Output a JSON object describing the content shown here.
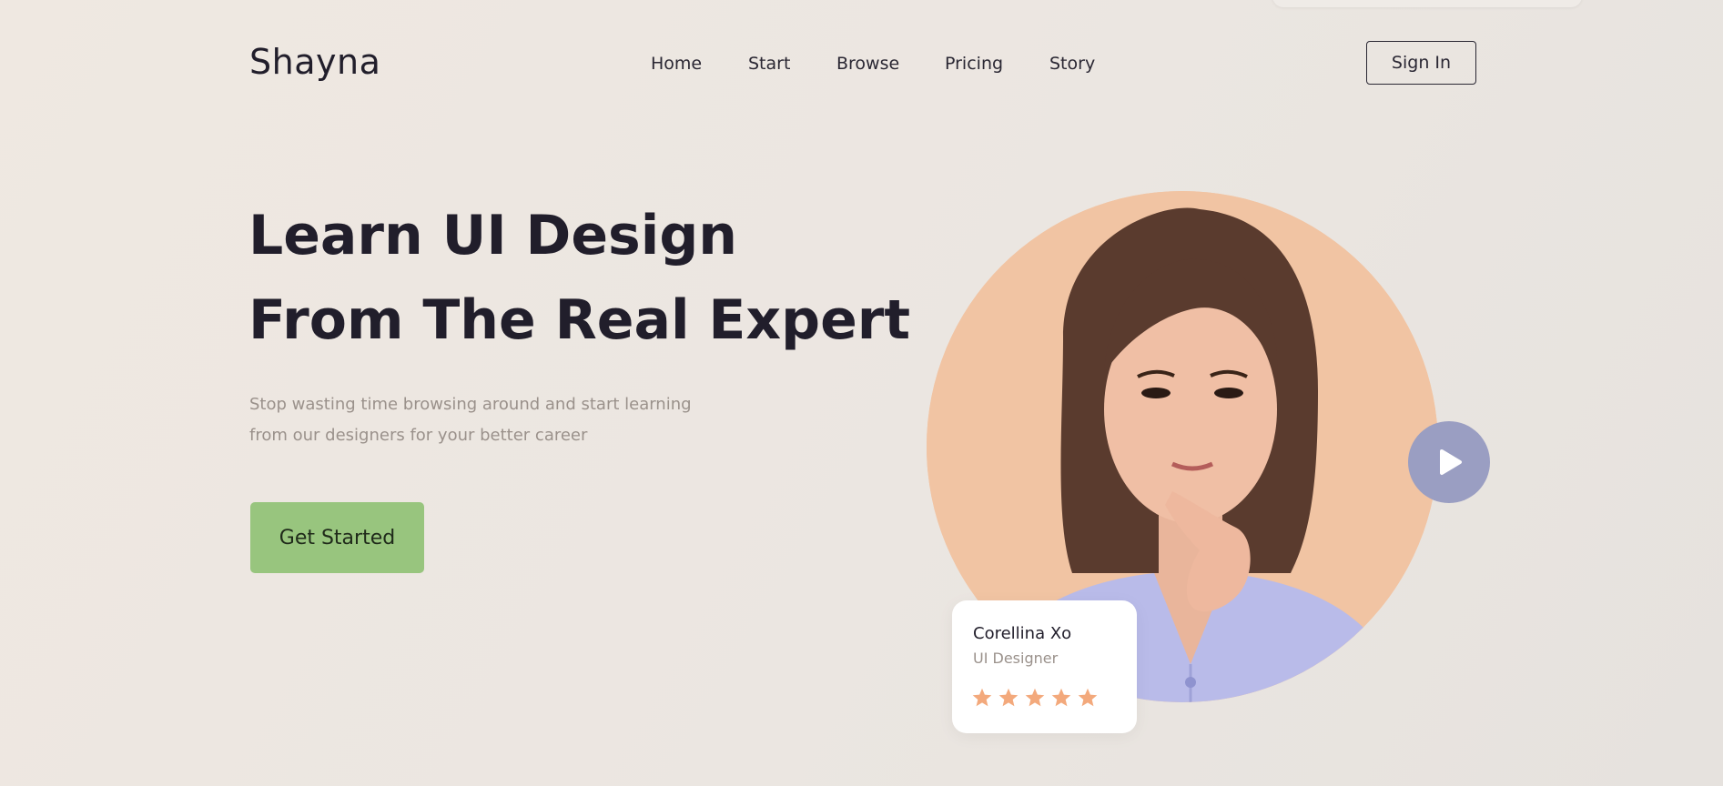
{
  "brand": {
    "logo_text": "Shayna"
  },
  "nav": {
    "items": [
      {
        "label": "Home"
      },
      {
        "label": "Start"
      },
      {
        "label": "Browse"
      },
      {
        "label": "Pricing"
      },
      {
        "label": "Story"
      }
    ],
    "sign_in_label": "Sign In"
  },
  "hero": {
    "headline_line1": "Learn UI Design",
    "headline_line2": "From The Real Expert",
    "subtext_line1": "Stop wasting time browsing around and start learning",
    "subtext_line2": "from our designers for your better career",
    "cta_label": "Get Started",
    "play_icon": "play-icon",
    "portrait_icon": "expert-portrait"
  },
  "expert_card": {
    "name": "Corellina Xo",
    "role": "UI Designer",
    "rating": 5,
    "rating_max": 5,
    "star_icon": "star-icon"
  },
  "colors": {
    "background": "#ece6e0",
    "text_dark": "#211e2b",
    "text_muted": "#9a918b",
    "cta_green": "#98c57e",
    "portrait_peach": "#f1c4a3",
    "play_button": "#9a9ec2",
    "star_orange": "#f3a97c"
  }
}
